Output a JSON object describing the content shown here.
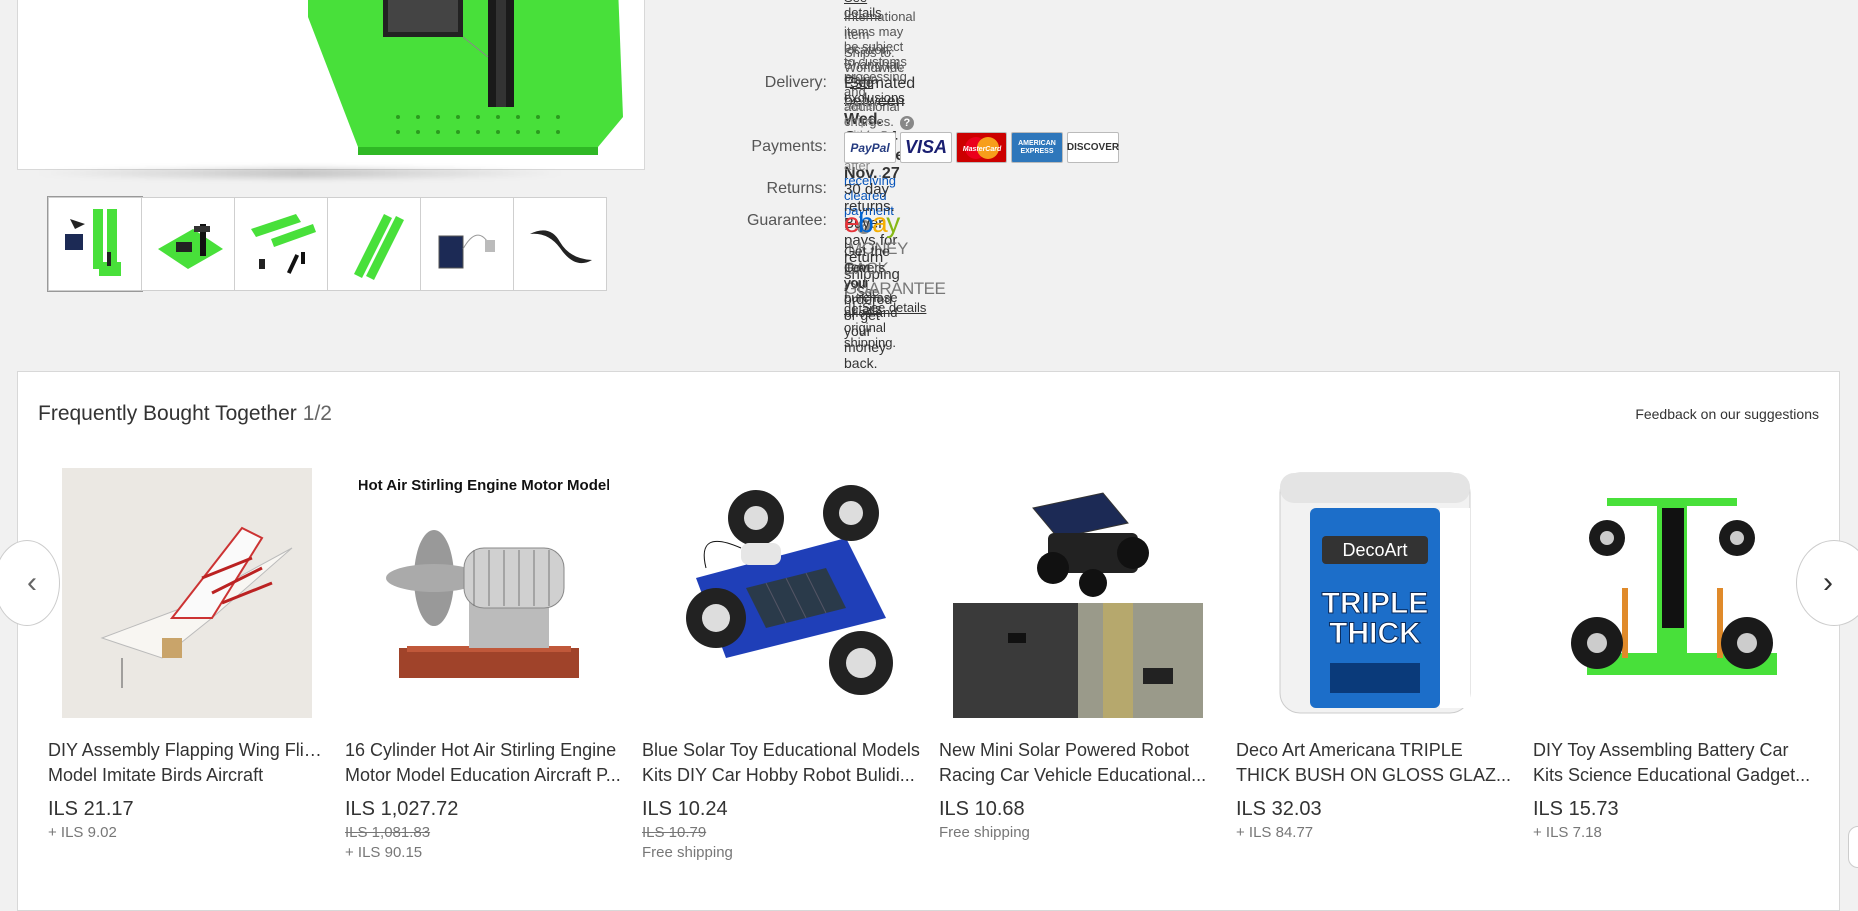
{
  "item": {
    "see_details_top": "See details",
    "international_note": "International items may be subject to customs processing and additional charges.",
    "location_label": "Item location:",
    "location_value": "Shanghai, China",
    "ships_label": "Ships to:",
    "ships_value": "Worldwide",
    "see_exclusions": "See exclusions",
    "delivery_label": "Delivery:",
    "delivery_prefix": "Estimated between",
    "delivery_dates": "Wed. Oct. 24 and Tue. Nov. 27",
    "seller_ships": "Seller ships within 2 days after",
    "receiving_payment": "receiving cleared payment",
    "payments_label": "Payments:",
    "payment_logos": [
      "PayPal",
      "VISA",
      "MasterCard",
      "AMERICAN EXPRESS",
      "DISCOVER"
    ],
    "returns_label": "Returns:",
    "returns_text": "30 day returns. Buyer pays for return shipping",
    "returns_see_details": "See details",
    "guarantee_label": "Guarantee:",
    "ebay_logo": "ebay",
    "money_back": "MONEY BACK GUARANTEE",
    "guarantee_see_details": "See details",
    "guarantee_line1": "Get the item you ordered or get your money back.",
    "guarantee_line2": "Covers your purchase price and original shipping."
  },
  "fbt": {
    "title": "Frequently Bought Together",
    "count": "1/2",
    "feedback": "Feedback on our suggestions",
    "products": [
      {
        "title1": "DIY Assembly Flapping Wing Flight",
        "title2": "Model Imitate Birds Aircraft",
        "price": "ILS 21.17",
        "old_price": "",
        "shipping": "+ ILS 9.02"
      },
      {
        "title1": "16 Cylinder Hot Air Stirling Engine",
        "title2": "Motor Model Education Aircraft P...",
        "price": "ILS 1,027.72",
        "old_price": "ILS 1,081.83",
        "shipping": "+ ILS 90.15",
        "img_caption": "Hot Air Stirling Engine Motor Model"
      },
      {
        "title1": "Blue Solar Toy Educational Models",
        "title2": "Kits DIY Car Hobby Robot Bulidi...",
        "price": "ILS 10.24",
        "old_price": "ILS 10.79",
        "shipping": "Free shipping"
      },
      {
        "title1": "New Mini Solar Powered Robot",
        "title2": "Racing Car Vehicle Educational...",
        "price": "ILS 10.68",
        "old_price": "",
        "shipping": "Free shipping"
      },
      {
        "title1": "Deco Art Americana TRIPLE",
        "title2": "THICK BUSH ON GLOSS GLAZ...",
        "price": "ILS 32.03",
        "old_price": "",
        "shipping": "+ ILS 84.77",
        "img_brand": "DecoArt",
        "img_line1": "TRIPLE",
        "img_line2": "THICK"
      },
      {
        "title1": "DIY Toy Assembling Battery Car",
        "title2": "Kits Science Educational Gadget...",
        "price": "ILS 15.73",
        "old_price": "",
        "shipping": "+ ILS 7.18"
      }
    ]
  },
  "colors": {
    "accent_green": "#48e03a",
    "link_blue": "#0654ba",
    "ebay_red": "#e53238",
    "ebay_blue": "#0064d2",
    "ebay_yellow": "#f5af02",
    "ebay_green": "#86b817"
  },
  "icons": {
    "left_arrow": "chevron-left-icon",
    "right_arrow": "chevron-right-icon",
    "help": "question-mark-icon"
  }
}
